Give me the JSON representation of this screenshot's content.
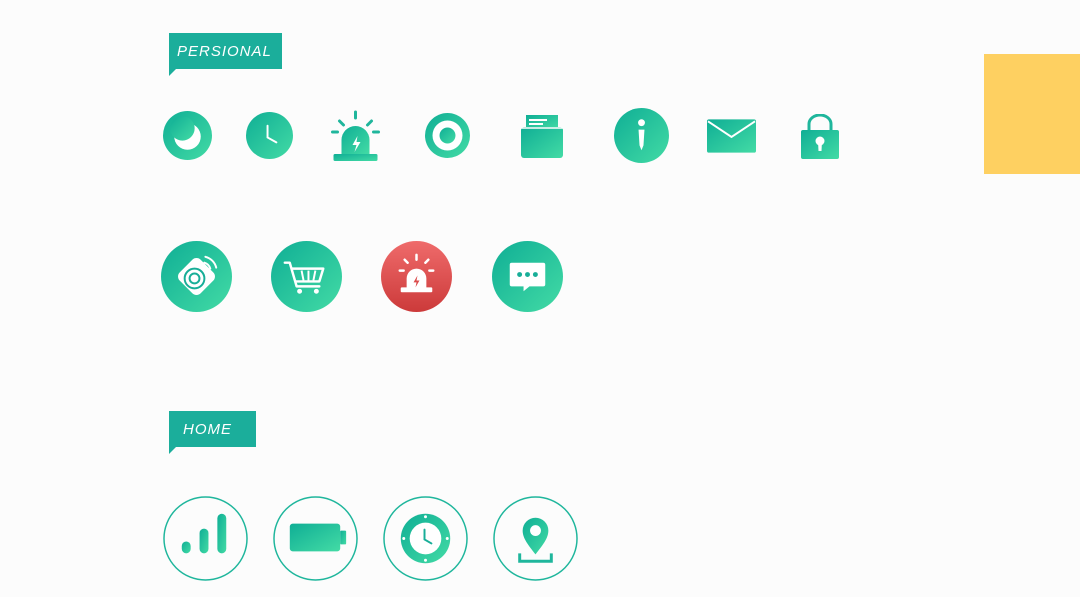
{
  "sections": {
    "personal": {
      "label": "PERSIONAL"
    },
    "home": {
      "label": "HOME"
    }
  },
  "colors": {
    "gradient_start": "#0fae95",
    "gradient_end": "#43dba5",
    "alert_red_start": "#ef6b6b",
    "alert_red_end": "#cc3a3a",
    "accent_swatch": "#fed061",
    "background": "#fcfcfc"
  },
  "icons": {
    "personal_row1": [
      "moon-icon",
      "clock-icon",
      "siren-icon",
      "radio-target-icon",
      "inbox-tray-icon",
      "info-icon",
      "mail-icon",
      "padlock-icon"
    ],
    "personal_row2": [
      "vibration-device-icon",
      "shopping-cart-icon",
      "alarm-siren-icon",
      "chat-bubble-icon"
    ],
    "home_row": [
      "signal-bars-icon",
      "battery-icon",
      "timer-icon",
      "location-pin-icon"
    ]
  }
}
